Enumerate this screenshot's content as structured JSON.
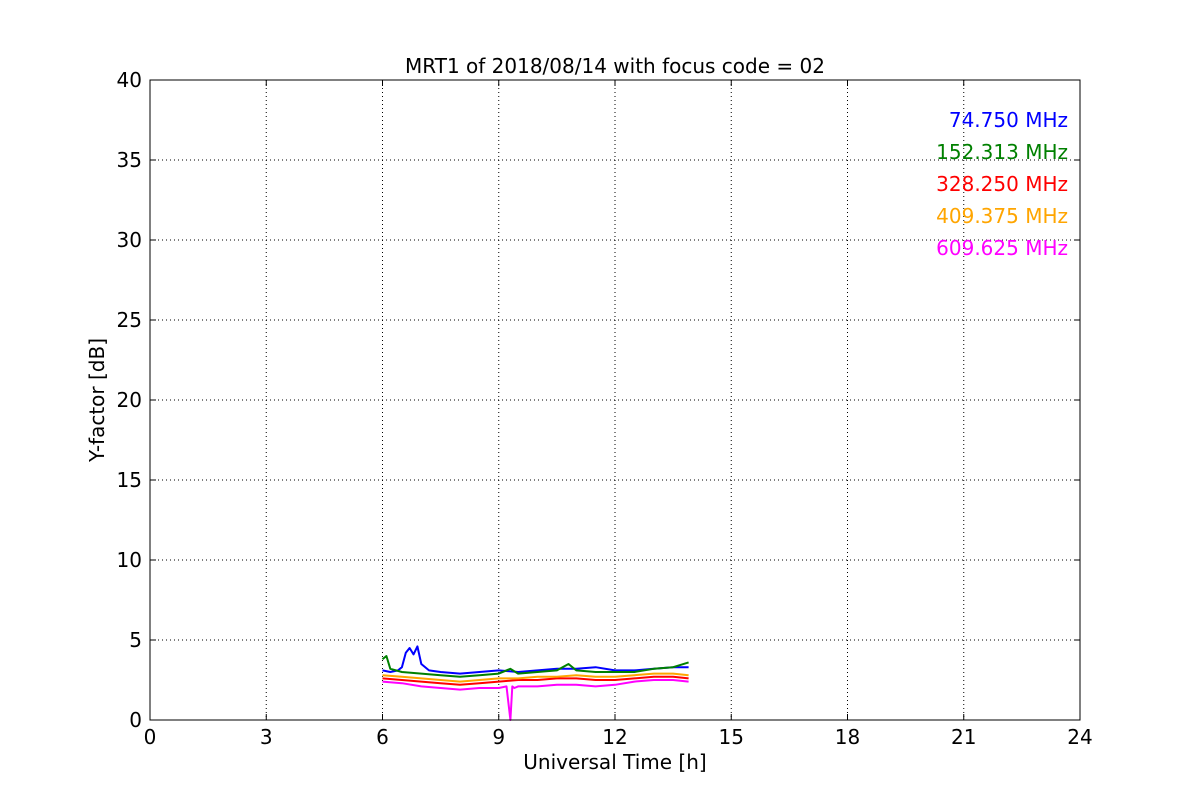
{
  "chart_data": {
    "type": "line",
    "title": "MRT1 of 2018/08/14 with focus code = 02",
    "xlabel": "Universal Time [h]",
    "ylabel": "Y-factor [dB]",
    "xlim": [
      0,
      24
    ],
    "ylim": [
      0,
      40
    ],
    "xticks": [
      "0",
      "3",
      "6",
      "9",
      "12",
      "15",
      "18",
      "21",
      "24"
    ],
    "yticks": [
      "0",
      "5",
      "10",
      "15",
      "20",
      "25",
      "30",
      "35",
      "40"
    ],
    "grid": true,
    "legend_placement": "top-right",
    "series": [
      {
        "name": "74.750 MHz",
        "color": "#0000ff",
        "x": [
          6.0,
          6.2,
          6.4,
          6.5,
          6.6,
          6.7,
          6.8,
          6.9,
          7.0,
          7.2,
          7.5,
          8.0,
          8.5,
          9.0,
          9.5,
          10.0,
          10.5,
          11.0,
          11.5,
          12.0,
          12.5,
          13.0,
          13.5,
          13.9
        ],
        "y": [
          3.1,
          3.0,
          3.1,
          3.3,
          4.2,
          4.5,
          4.1,
          4.6,
          3.5,
          3.1,
          3.0,
          2.9,
          3.0,
          3.1,
          3.0,
          3.1,
          3.2,
          3.2,
          3.3,
          3.1,
          3.1,
          3.2,
          3.3,
          3.3
        ]
      },
      {
        "name": "152.313 MHz",
        "color": "#008000",
        "x": [
          6.0,
          6.1,
          6.2,
          6.5,
          7.0,
          7.5,
          8.0,
          8.5,
          9.0,
          9.3,
          9.5,
          10.0,
          10.5,
          10.8,
          11.0,
          11.5,
          12.0,
          12.5,
          13.0,
          13.5,
          13.9
        ],
        "y": [
          3.8,
          4.0,
          3.2,
          3.0,
          2.9,
          2.8,
          2.7,
          2.8,
          2.9,
          3.2,
          2.9,
          3.0,
          3.1,
          3.5,
          3.1,
          3.0,
          3.0,
          3.0,
          3.2,
          3.3,
          3.6
        ]
      },
      {
        "name": "328.250 MHz",
        "color": "#ff0000",
        "x": [
          6.0,
          6.5,
          7.0,
          7.5,
          8.0,
          8.5,
          9.0,
          9.5,
          10.0,
          10.5,
          11.0,
          11.5,
          12.0,
          12.5,
          13.0,
          13.5,
          13.9
        ],
        "y": [
          2.6,
          2.5,
          2.4,
          2.3,
          2.2,
          2.3,
          2.4,
          2.5,
          2.5,
          2.6,
          2.6,
          2.5,
          2.5,
          2.6,
          2.7,
          2.7,
          2.6
        ]
      },
      {
        "name": "409.375 MHz",
        "color": "#ffa500",
        "x": [
          6.0,
          6.5,
          7.0,
          7.5,
          8.0,
          8.5,
          9.0,
          9.5,
          10.0,
          10.5,
          11.0,
          11.5,
          12.0,
          12.5,
          13.0,
          13.5,
          13.9
        ],
        "y": [
          2.8,
          2.7,
          2.6,
          2.5,
          2.4,
          2.5,
          2.6,
          2.6,
          2.7,
          2.7,
          2.8,
          2.7,
          2.7,
          2.8,
          2.9,
          2.9,
          2.8
        ]
      },
      {
        "name": "609.625 MHz",
        "color": "#ff00ff",
        "x": [
          6.0,
          6.5,
          7.0,
          7.5,
          8.0,
          8.5,
          9.0,
          9.2,
          9.3,
          9.35,
          9.4,
          9.5,
          10.0,
          10.5,
          11.0,
          11.5,
          12.0,
          12.5,
          13.0,
          13.5,
          13.9
        ],
        "y": [
          2.4,
          2.3,
          2.1,
          2.0,
          1.9,
          2.0,
          2.0,
          2.1,
          0.0,
          2.1,
          2.0,
          2.1,
          2.1,
          2.2,
          2.2,
          2.1,
          2.2,
          2.4,
          2.5,
          2.5,
          2.4
        ]
      }
    ]
  }
}
